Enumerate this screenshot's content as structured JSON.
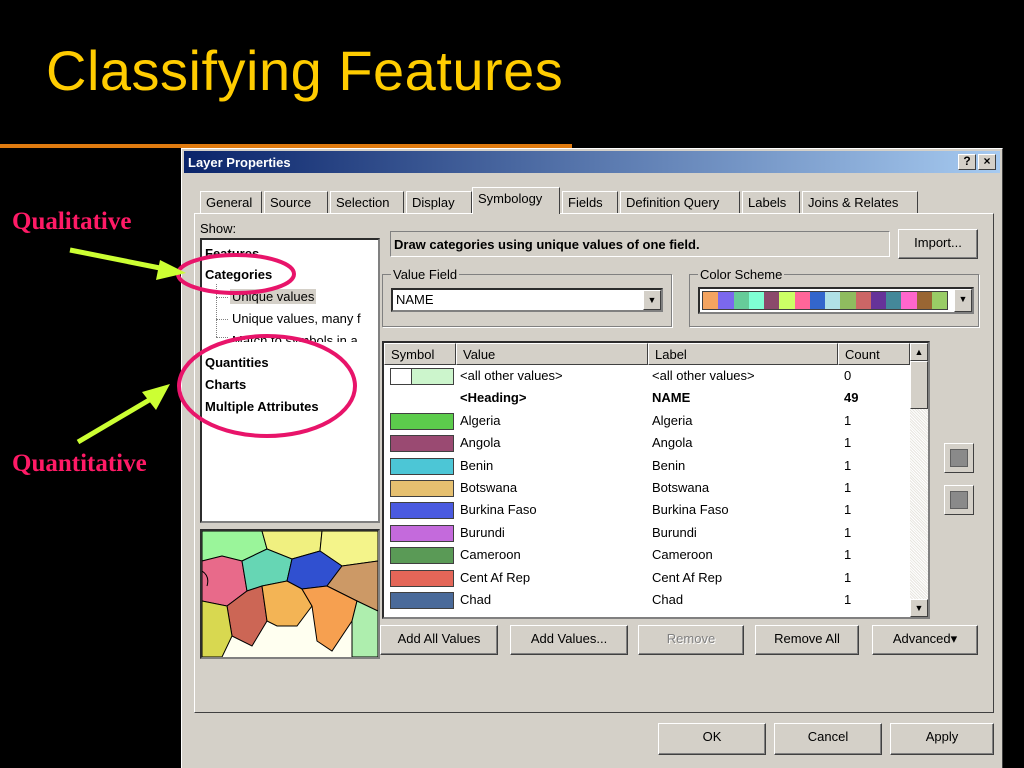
{
  "slide": {
    "title": "Classifying Features",
    "qualitative_label": "Qualitative",
    "quantitative_label": "Quantitative"
  },
  "colors": {
    "title": "#ffcc00",
    "rule": "#e07b10",
    "annotation": "#ff1a66",
    "arrow": "#ccff33"
  },
  "window": {
    "title": "Layer Properties",
    "help_button": "?",
    "close_button": "×"
  },
  "tabs": [
    "General",
    "Source",
    "Selection",
    "Display",
    "Symbology",
    "Fields",
    "Definition Query",
    "Labels",
    "Joins & Relates"
  ],
  "active_tab": "Symbology",
  "show": {
    "label": "Show:",
    "features": "Features",
    "categories": "Categories",
    "unique_values": "Unique values",
    "unique_values_many": "Unique values, many f",
    "match_symbols": "Match to symbols in a",
    "quantities": "Quantities",
    "charts": "Charts",
    "multiple_attributes": "Multiple Attributes"
  },
  "description": "Draw categories using unique values of one field.",
  "import_button": "Import...",
  "value_field": {
    "label": "Value Field",
    "value": "NAME"
  },
  "color_scheme": {
    "label": "Color Scheme",
    "swatches": [
      "#f4a460",
      "#7b68ee",
      "#66cc99",
      "#7fffd4",
      "#8b4a6b",
      "#ccff66",
      "#ff6699",
      "#3366cc",
      "#b0e0e6",
      "#8fbc5f",
      "#cc6666",
      "#663399",
      "#448899",
      "#ff66cc",
      "#996633",
      "#99cc66"
    ]
  },
  "table": {
    "headers": [
      "Symbol",
      "Value",
      "Label",
      "Count"
    ],
    "rows": [
      {
        "color": "#ccf5cc",
        "value": "<all other values>",
        "label": "<all other values>",
        "count": "0",
        "bold": false
      },
      {
        "color": "",
        "value": "<Heading>",
        "label": "NAME",
        "count": "49",
        "bold": true
      },
      {
        "color": "#5ccc4c",
        "value": "Algeria",
        "label": "Algeria",
        "count": "1",
        "bold": false
      },
      {
        "color": "#9a4a72",
        "value": "Angola",
        "label": "Angola",
        "count": "1",
        "bold": false
      },
      {
        "color": "#4cc6d6",
        "value": "Benin",
        "label": "Benin",
        "count": "1",
        "bold": false
      },
      {
        "color": "#e6c070",
        "value": "Botswana",
        "label": "Botswana",
        "count": "1",
        "bold": false
      },
      {
        "color": "#4a5ae0",
        "value": "Burkina Faso",
        "label": "Burkina Faso",
        "count": "1",
        "bold": false
      },
      {
        "color": "#c46adc",
        "value": "Burundi",
        "label": "Burundi",
        "count": "1",
        "bold": false
      },
      {
        "color": "#5a9a56",
        "value": "Cameroon",
        "label": "Cameroon",
        "count": "1",
        "bold": false
      },
      {
        "color": "#e46658",
        "value": "Cent Af Rep",
        "label": "Cent Af Rep",
        "count": "1",
        "bold": false
      },
      {
        "color": "#4a6a9a",
        "value": "Chad",
        "label": "Chad",
        "count": "1",
        "bold": false
      }
    ]
  },
  "buttons": {
    "add_all": "Add All Values",
    "add_values": "Add Values...",
    "remove": "Remove",
    "remove_all": "Remove All",
    "advanced": "Advanced▾",
    "ok": "OK",
    "cancel": "Cancel",
    "apply": "Apply"
  }
}
